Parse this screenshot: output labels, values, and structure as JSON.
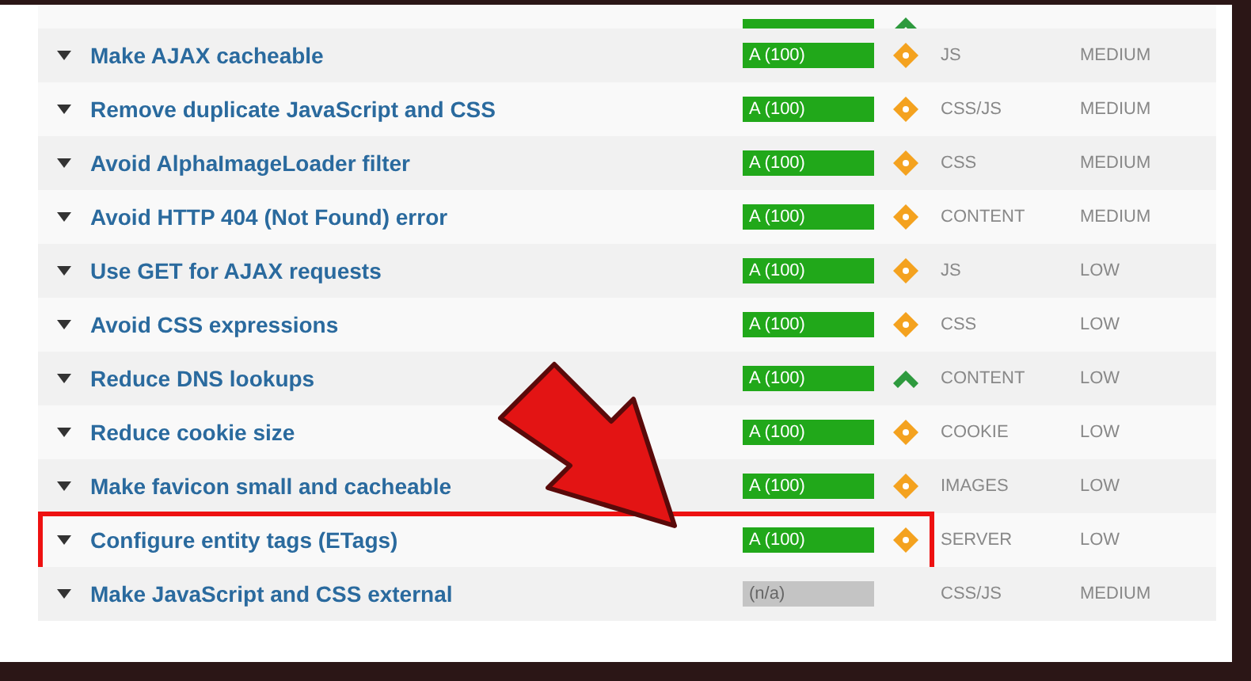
{
  "top_partial_row": {
    "grade": {
      "kind": "pass"
    },
    "trend": {
      "kind": "up"
    }
  },
  "rows": [
    {
      "title": "Make AJAX cacheable",
      "grade": {
        "text": "A (100)",
        "kind": "pass"
      },
      "trend": {
        "kind": "diamond"
      },
      "category": "JS",
      "priority": "MEDIUM",
      "highlighted": false
    },
    {
      "title": "Remove duplicate JavaScript and CSS",
      "grade": {
        "text": "A (100)",
        "kind": "pass"
      },
      "trend": {
        "kind": "diamond"
      },
      "category": "CSS/JS",
      "priority": "MEDIUM",
      "highlighted": false
    },
    {
      "title": "Avoid AlphaImageLoader filter",
      "grade": {
        "text": "A (100)",
        "kind": "pass"
      },
      "trend": {
        "kind": "diamond"
      },
      "category": "CSS",
      "priority": "MEDIUM",
      "highlighted": false
    },
    {
      "title": "Avoid HTTP 404 (Not Found) error",
      "grade": {
        "text": "A (100)",
        "kind": "pass"
      },
      "trend": {
        "kind": "diamond"
      },
      "category": "CONTENT",
      "priority": "MEDIUM",
      "highlighted": false
    },
    {
      "title": "Use GET for AJAX requests",
      "grade": {
        "text": "A (100)",
        "kind": "pass"
      },
      "trend": {
        "kind": "diamond"
      },
      "category": "JS",
      "priority": "LOW",
      "highlighted": false
    },
    {
      "title": "Avoid CSS expressions",
      "grade": {
        "text": "A (100)",
        "kind": "pass"
      },
      "trend": {
        "kind": "diamond"
      },
      "category": "CSS",
      "priority": "LOW",
      "highlighted": false
    },
    {
      "title": "Reduce DNS lookups",
      "grade": {
        "text": "A (100)",
        "kind": "pass"
      },
      "trend": {
        "kind": "up"
      },
      "category": "CONTENT",
      "priority": "LOW",
      "highlighted": false
    },
    {
      "title": "Reduce cookie size",
      "grade": {
        "text": "A (100)",
        "kind": "pass"
      },
      "trend": {
        "kind": "diamond"
      },
      "category": "COOKIE",
      "priority": "LOW",
      "highlighted": false
    },
    {
      "title": "Make favicon small and cacheable",
      "grade": {
        "text": "A (100)",
        "kind": "pass"
      },
      "trend": {
        "kind": "diamond"
      },
      "category": "IMAGES",
      "priority": "LOW",
      "highlighted": false
    },
    {
      "title": "Configure entity tags (ETags)",
      "grade": {
        "text": "A (100)",
        "kind": "pass"
      },
      "trend": {
        "kind": "diamond"
      },
      "category": "SERVER",
      "priority": "LOW",
      "highlighted": true
    },
    {
      "title": "Make JavaScript and CSS external",
      "grade": {
        "text": "(n/a)",
        "kind": "na"
      },
      "category": "CSS/JS",
      "priority": "MEDIUM",
      "highlighted": false
    }
  ]
}
